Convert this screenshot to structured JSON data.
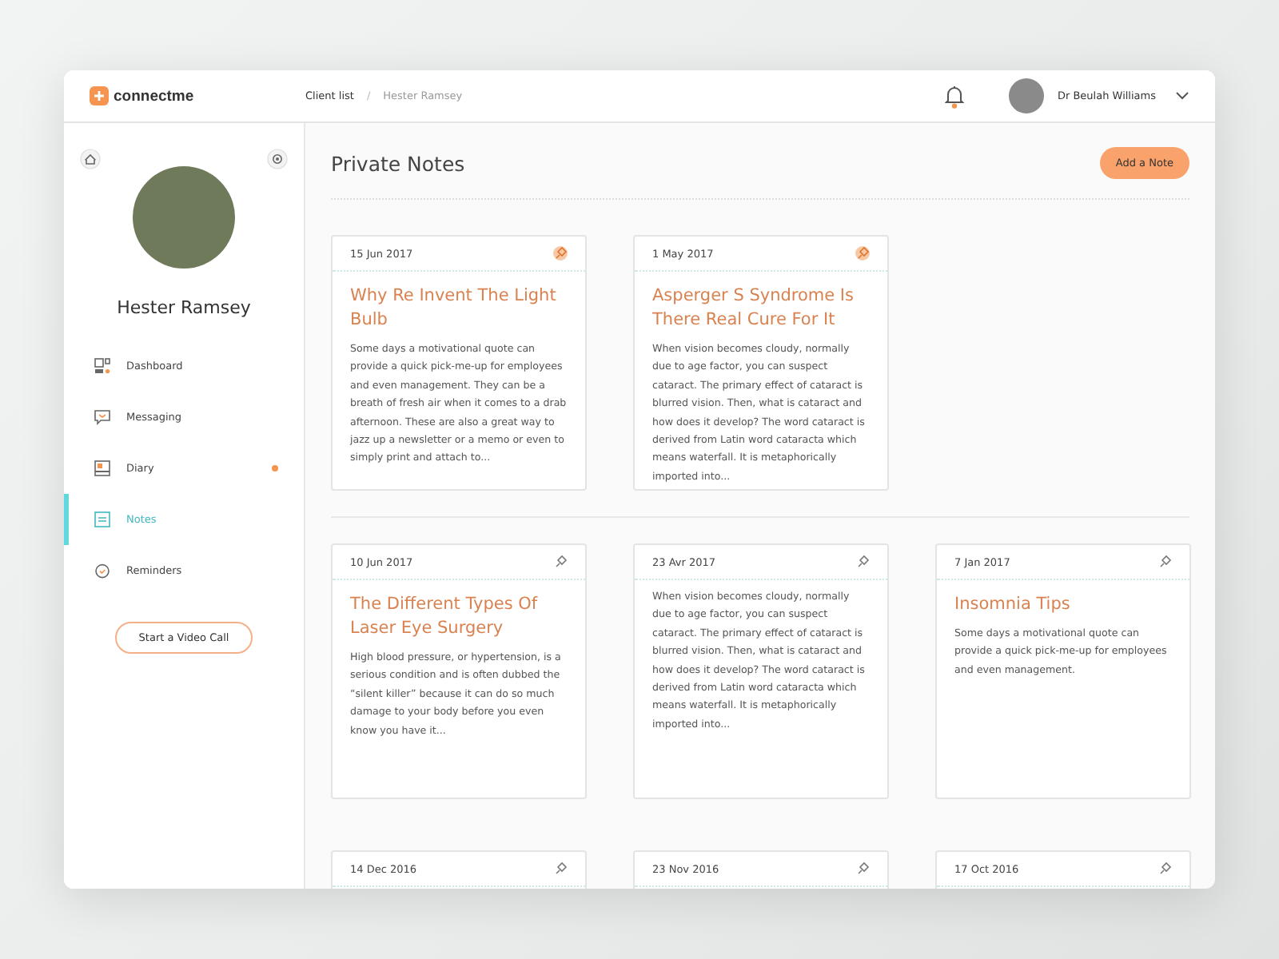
{
  "header": {
    "logo": "connectme",
    "breadcrumb_separator": "/",
    "breadcrumb": [
      {
        "label": "Client list",
        "current": false
      },
      {
        "label": "Hester Ramsey",
        "current": true
      }
    ],
    "notification_dot": true,
    "user": "Dr Beulah Williams"
  },
  "sidebar": {
    "client_name": "Hester Ramsey",
    "items": [
      {
        "label": "Dashboard",
        "selected": false,
        "dot": false
      },
      {
        "label": "Messaging",
        "selected": false,
        "dot": false
      },
      {
        "label": "Diary",
        "selected": false,
        "dot": true
      },
      {
        "label": "Notes",
        "selected": true,
        "dot": false
      },
      {
        "label": "Reminders",
        "selected": false,
        "dot": false
      }
    ],
    "video_button": "Start a Video Call"
  },
  "main": {
    "title": "Private Notes",
    "add_button": "Add a Note",
    "pinned_notes": [
      {
        "date": "15 Jun 2017",
        "pinned": true,
        "title": "Why Re Invent The Light Bulb",
        "body": "Some days a motivational quote can provide a quick pick-me-up for employees and even management. They can be a breath of fresh air when it comes to a drab afternoon. These are also a great way to jazz up a newsletter or a memo or even to simply print and attach to..."
      },
      {
        "date": "1 May 2017",
        "pinned": true,
        "title": "Asperger S Syndrome Is There Real Cure For It",
        "body": "When vision becomes cloudy, normally due to age factor, you can suspect cataract. The primary effect of cataract is blurred vision. Then, what is cataract and how does it develop? The word cataract is derived from Latin word cataracta which means waterfall. It is metaphorically imported into..."
      }
    ],
    "notes": [
      {
        "date": "10 Jun 2017",
        "pinned": false,
        "title": "The Different Types Of Laser Eye Surgery",
        "body": "High blood pressure, or hypertension, is a serious condition and is often dubbed the “silent killer” because it can do so much damage to your body before you even know you have it..."
      },
      {
        "date": "23 Avr 2017",
        "pinned": false,
        "body": "When vision becomes cloudy, normally due to age factor, you can suspect cataract. The primary effect of cataract is blurred vision. Then, what is cataract and how does it develop? The word cataract is derived from Latin word cataracta which means waterfall. It is metaphorically imported into..."
      },
      {
        "date": "7 Jan 2017",
        "pinned": false,
        "title": "Insomnia Tips",
        "body": "Some days a motivational quote can provide a quick pick-me-up for employees and even management."
      },
      {
        "date": "14 Dec 2016",
        "pinned": false
      },
      {
        "date": "23 Nov 2016",
        "pinned": false
      },
      {
        "date": "17 Oct 2016",
        "pinned": false
      }
    ]
  }
}
